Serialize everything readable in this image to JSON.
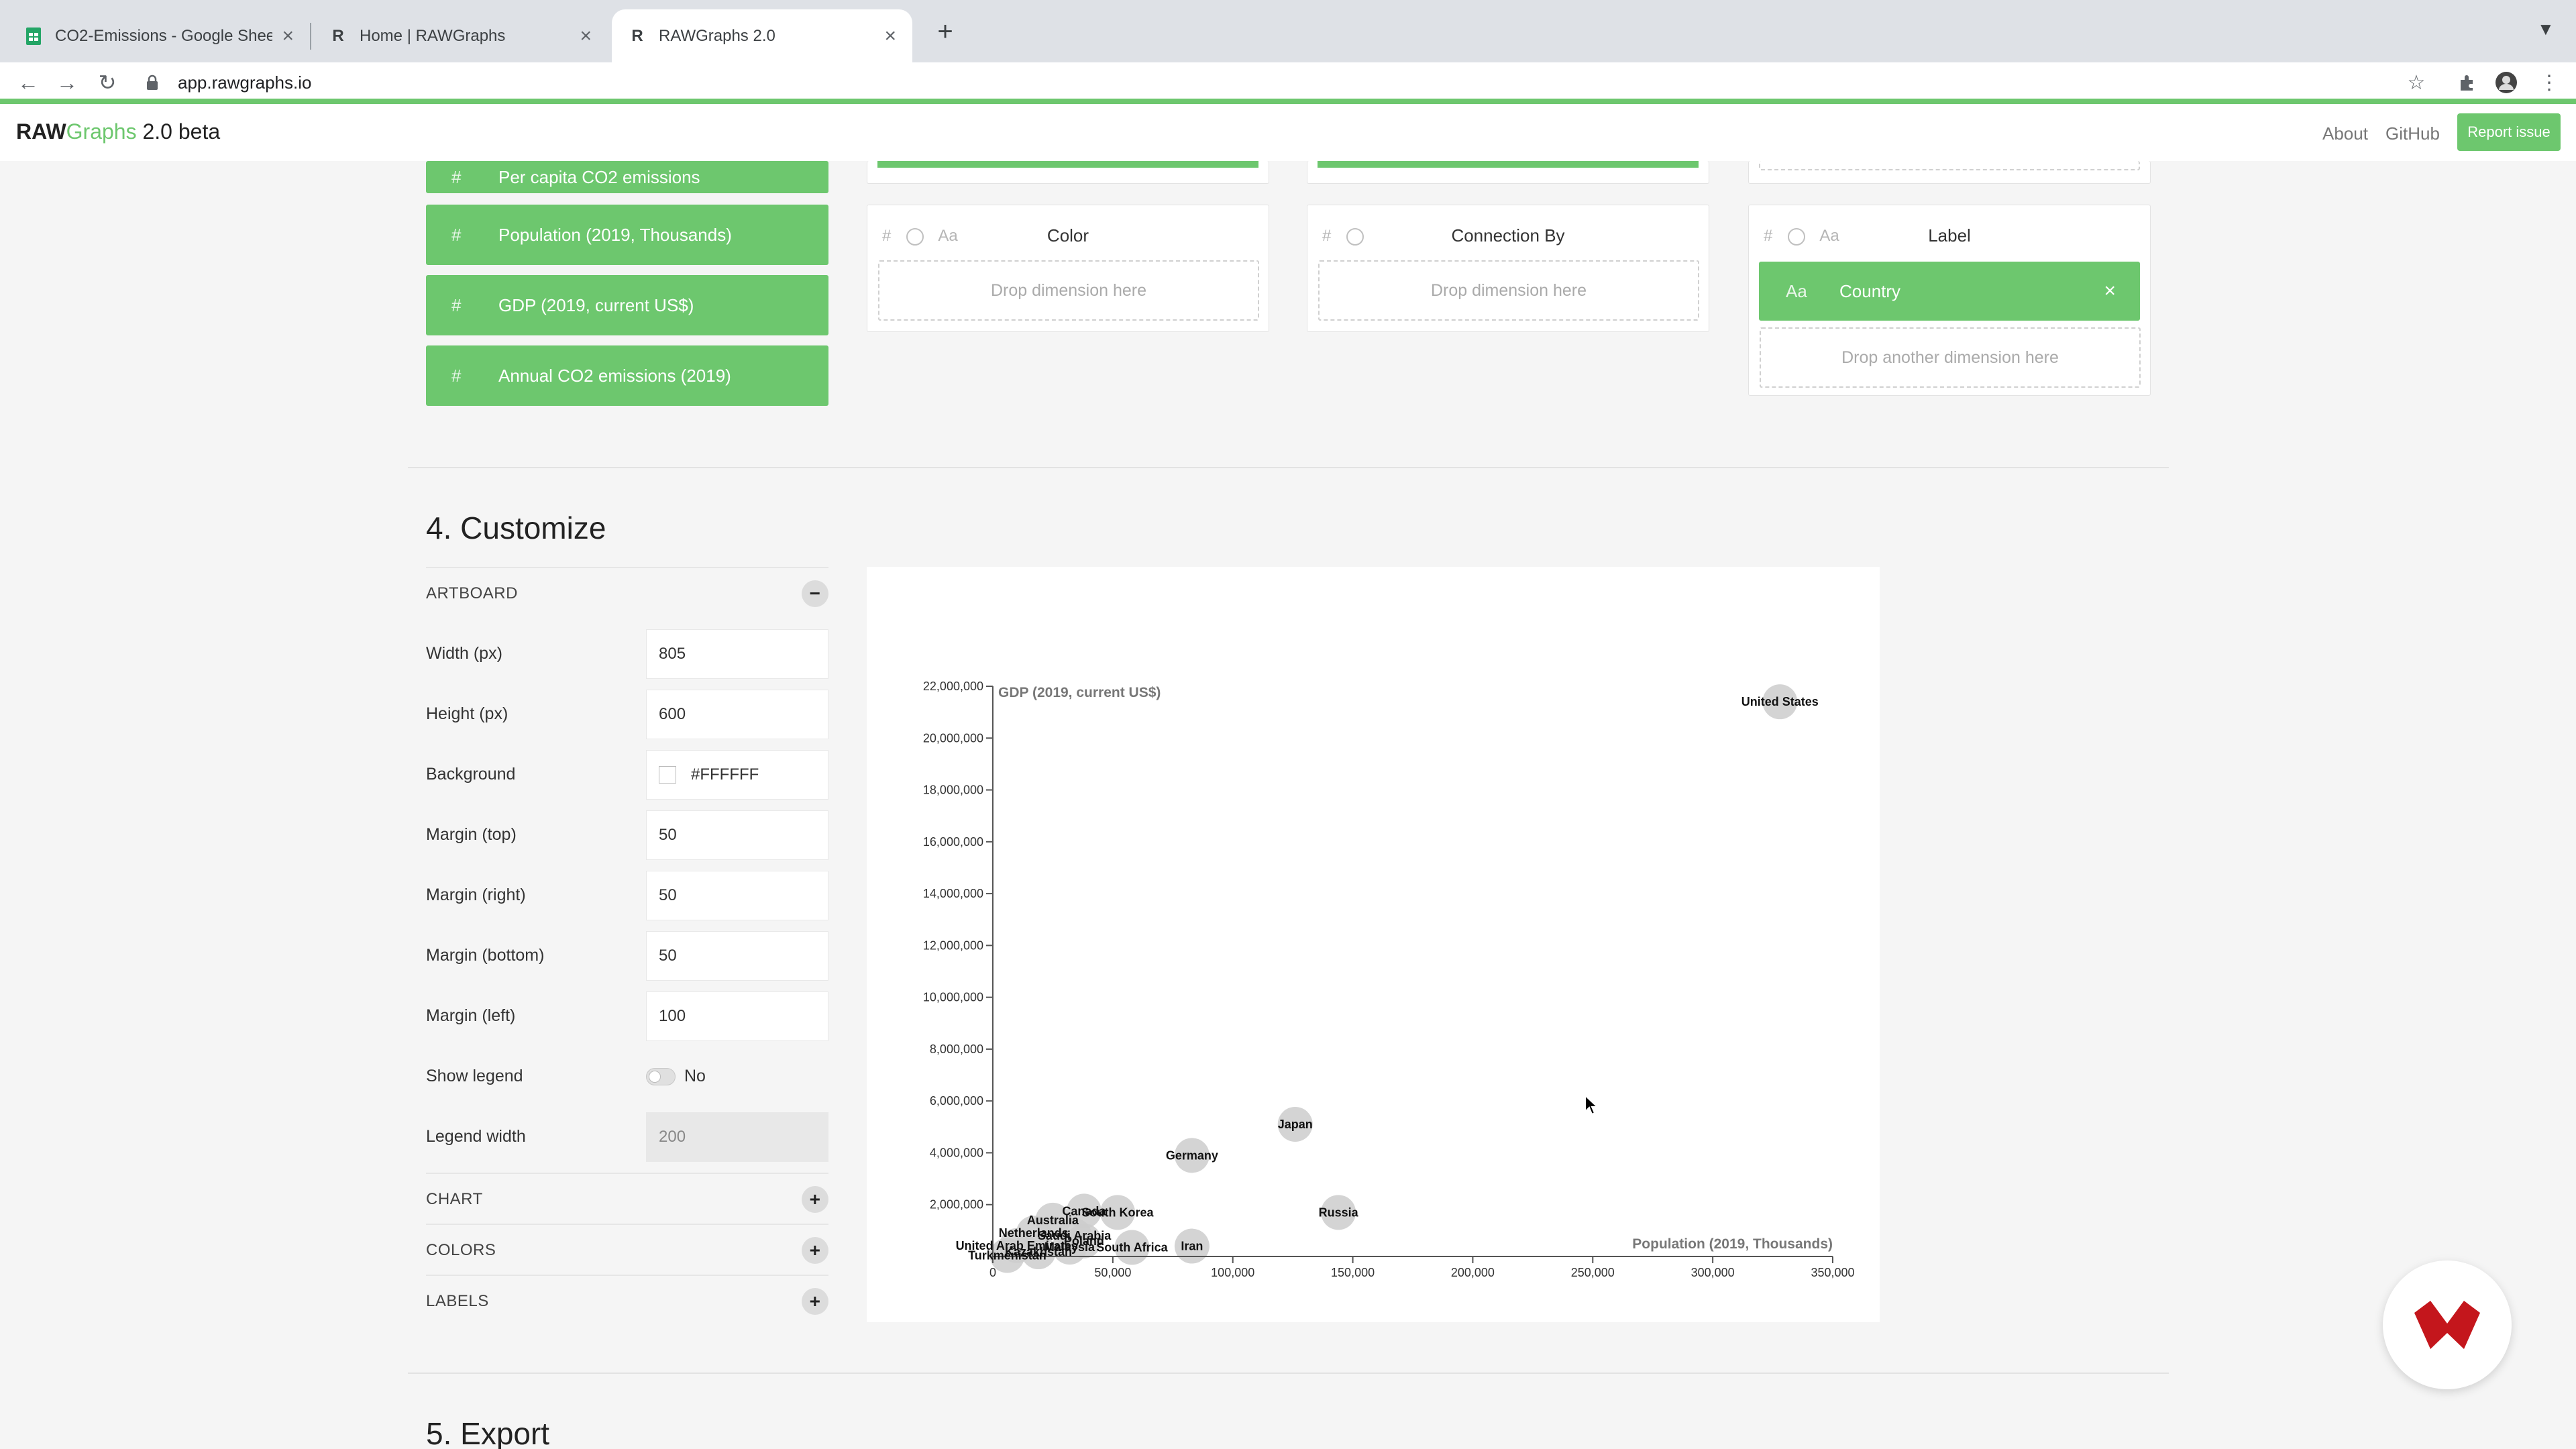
{
  "browser": {
    "tabs": [
      {
        "title": "CO2-Emissions - Google Shee",
        "favicon": "sheets-icon"
      },
      {
        "title": "Home | RAWGraphs",
        "favicon": "rawgraphs-icon"
      },
      {
        "title": "RAWGraphs 2.0",
        "favicon": "rawgraphs-icon"
      }
    ],
    "url": "app.rawgraphs.io",
    "favicon_letter": "R"
  },
  "app": {
    "brand_raw": "RAW",
    "brand_graphs": "Graphs",
    "brand_version": " 2.0 beta",
    "nav": {
      "about": "About",
      "github": "GitHub",
      "report": "Report issue"
    }
  },
  "dimensions": {
    "items": [
      {
        "label": "Per capita CO2 emissions",
        "type": "#"
      },
      {
        "label": "Population (2019, Thousands)",
        "type": "#"
      },
      {
        "label": "GDP (2019, current US$)",
        "type": "#"
      },
      {
        "label": "Annual CO2 emissions (2019)",
        "type": "#"
      }
    ]
  },
  "mapping": {
    "type_hash": "#",
    "type_text": "Aa",
    "color": {
      "title": "Color",
      "drop": "Drop dimension here"
    },
    "connection": {
      "title": "Connection By",
      "drop": "Drop dimension here"
    },
    "label": {
      "title": "Label",
      "chip_type": "Aa",
      "chip": "Country",
      "chip_close": "×",
      "drop": "Drop another dimension here"
    }
  },
  "customize": {
    "title": "4. Customize",
    "artboard_label": "ARTBOARD",
    "collapse": "−",
    "rows": {
      "width": {
        "label": "Width (px)",
        "value": "805"
      },
      "height": {
        "label": "Height (px)",
        "value": "600"
      },
      "background": {
        "label": "Background",
        "value": "#FFFFFF"
      },
      "margin_top": {
        "label": "Margin (top)",
        "value": "50"
      },
      "margin_right": {
        "label": "Margin (right)",
        "value": "50"
      },
      "margin_bottom": {
        "label": "Margin (bottom)",
        "value": "50"
      },
      "margin_left": {
        "label": "Margin (left)",
        "value": "100"
      },
      "show_legend": {
        "label": "Show legend",
        "value": "No"
      },
      "legend_width": {
        "label": "Legend width",
        "value": "200"
      }
    },
    "sections": [
      {
        "label": "CHART",
        "btn": "+"
      },
      {
        "label": "COLORS",
        "btn": "+"
      },
      {
        "label": "LABELS",
        "btn": "+"
      }
    ]
  },
  "export": {
    "title": "5. Export"
  },
  "colors": {
    "accent": "#6dc76e",
    "bubble": "#cccccc",
    "axis": "#555555"
  },
  "chart_data": {
    "type": "scatter",
    "title": "",
    "xlabel": "Population (2019, Thousands)",
    "ylabel": "GDP (2019, current US$)",
    "xlim": [
      0,
      350000
    ],
    "ylim": [
      0,
      22000000
    ],
    "x_ticks": [
      0,
      50000,
      100000,
      150000,
      200000,
      250000,
      300000,
      350000
    ],
    "x_tick_labels": [
      "0",
      "50,000",
      "100,000",
      "150,000",
      "200,000",
      "250,000",
      "300,000",
      "350,000"
    ],
    "y_ticks": [
      2000000,
      4000000,
      6000000,
      8000000,
      10000000,
      12000000,
      14000000,
      16000000,
      18000000,
      20000000,
      22000000
    ],
    "y_tick_labels": [
      "2,000,000",
      "4,000,000",
      "6,000,000",
      "8,000,000",
      "10,000,000",
      "12,000,000",
      "14,000,000",
      "16,000,000",
      "18,000,000",
      "20,000,000",
      "22,000,000"
    ],
    "grid": false,
    "points": [
      {
        "label": "United States",
        "x": 328000,
        "y": 21400000
      },
      {
        "label": "Japan",
        "x": 126000,
        "y": 5100000
      },
      {
        "label": "Germany",
        "x": 83000,
        "y": 3900000
      },
      {
        "label": "Russia",
        "x": 144000,
        "y": 1700000
      },
      {
        "label": "Iran",
        "x": 83000,
        "y": 400000
      },
      {
        "label": "South Korea",
        "x": 52000,
        "y": 1700000
      },
      {
        "label": "Canada",
        "x": 38000,
        "y": 1750000
      },
      {
        "label": "Australia",
        "x": 25000,
        "y": 1400000
      },
      {
        "label": "Saudi Arabia",
        "x": 34000,
        "y": 800000
      },
      {
        "label": "South Africa",
        "x": 58000,
        "y": 350000
      },
      {
        "label": "Netherlands",
        "x": 17000,
        "y": 900000
      },
      {
        "label": "Poland",
        "x": 38000,
        "y": 600000
      },
      {
        "label": "Malaysia",
        "x": 32000,
        "y": 360000
      },
      {
        "label": "Kazakhstan",
        "x": 19000,
        "y": 180000
      },
      {
        "label": "United Arab Emirates",
        "x": 10000,
        "y": 420000
      },
      {
        "label": "Turkmenistan",
        "x": 6000,
        "y": 40000
      }
    ]
  }
}
